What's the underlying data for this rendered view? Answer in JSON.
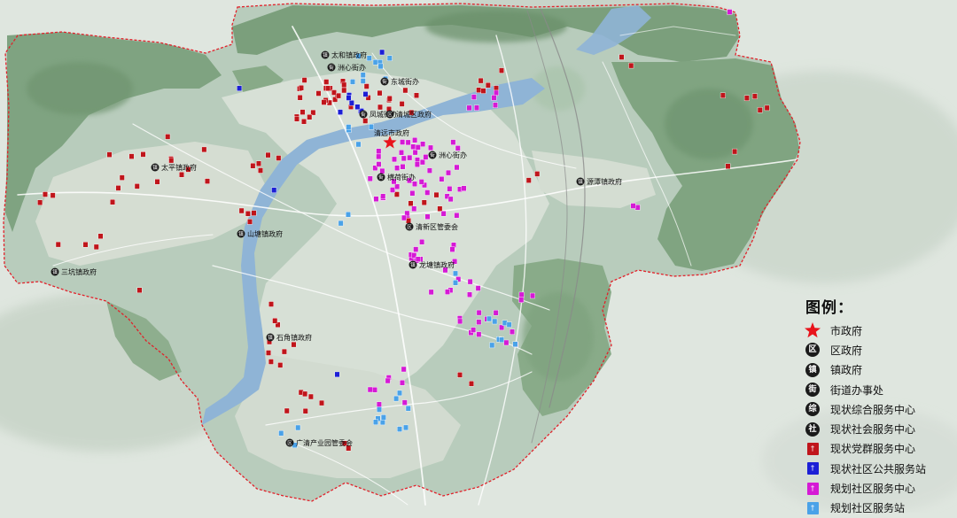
{
  "legend": {
    "title": "图例：",
    "items": [
      {
        "key": "city_gov",
        "label": "市政府",
        "symbol": "star-icon",
        "color": "#e8131b"
      },
      {
        "key": "district_gov",
        "label": "区政府",
        "symbol": "circle-badge-icon",
        "glyph": "区",
        "color": "#1a1a1a"
      },
      {
        "key": "town_gov",
        "label": "镇政府",
        "symbol": "circle-badge-icon",
        "glyph": "镇",
        "color": "#1a1a1a"
      },
      {
        "key": "subdistrict",
        "label": "街道办事处",
        "symbol": "circle-badge-icon",
        "glyph": "街",
        "color": "#1a1a1a"
      },
      {
        "key": "existing_comprehensive",
        "label": "现状综合服务中心",
        "symbol": "circle-badge-icon",
        "glyph": "综",
        "color": "#1a1a1a"
      },
      {
        "key": "existing_social",
        "label": "现状社会服务中心",
        "symbol": "circle-badge-icon",
        "glyph": "社",
        "color": "#1a1a1a"
      },
      {
        "key": "existing_party",
        "label": "现状党群服务中心",
        "symbol": "square-marker-icon",
        "color": "#c0151b"
      },
      {
        "key": "existing_public_station",
        "label": "现状社区公共服务站",
        "symbol": "square-marker-icon",
        "color": "#1c1fd6"
      },
      {
        "key": "planned_community_center",
        "label": "规划社区服务中心",
        "symbol": "square-marker-icon",
        "color": "#d51ad5"
      },
      {
        "key": "planned_community_station",
        "label": "规划社区服务站",
        "symbol": "square-marker-icon",
        "color": "#4aa2e8"
      }
    ]
  },
  "places": [
    {
      "label": "太和镇政府",
      "glyph": "镇"
    },
    {
      "label": "洲心街办",
      "glyph": "街"
    },
    {
      "label": "东城街办",
      "glyph": "街"
    },
    {
      "label": "凤城街办",
      "glyph": "街"
    },
    {
      "label": "清城区政府",
      "glyph": "区"
    },
    {
      "label": "清远市政府",
      "glyph": "star"
    },
    {
      "label": "横荷街办",
      "glyph": "街"
    },
    {
      "label": "源潭镇政府",
      "glyph": "镇"
    },
    {
      "label": "太平镇政府",
      "glyph": "镇"
    },
    {
      "label": "洲心街办",
      "glyph": "街"
    },
    {
      "label": "山塘镇政府",
      "glyph": "镇"
    },
    {
      "label": "清新区管委会",
      "glyph": "区"
    },
    {
      "label": "龙塘镇政府",
      "glyph": "镇"
    },
    {
      "label": "三坑镇政府",
      "glyph": "镇"
    },
    {
      "label": "石角镇政府",
      "glyph": "镇"
    },
    {
      "label": "广清产业园管委会",
      "glyph": "区"
    }
  ]
}
